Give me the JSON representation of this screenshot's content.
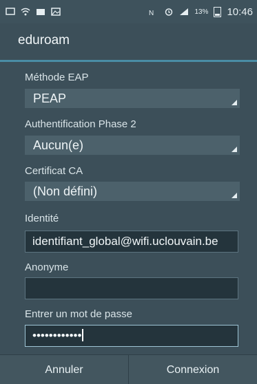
{
  "statusbar": {
    "battery_percent": "13%",
    "time": "10:46"
  },
  "dialog": {
    "title": "eduroam",
    "eap_method": {
      "label": "Méthode EAP",
      "value": "PEAP"
    },
    "phase2": {
      "label": "Authentification Phase 2",
      "value": "Aucun(e)"
    },
    "ca_cert": {
      "label": "Certificat CA",
      "value": "(Non défini)"
    },
    "identity": {
      "label": "Identité",
      "value": "identifiant_global@wifi.uclouvain.be"
    },
    "anonymous": {
      "label": "Anonyme",
      "value": ""
    },
    "password": {
      "label": "Entrer un mot de passe",
      "value": "••••••••••••"
    }
  },
  "buttons": {
    "cancel": "Annuler",
    "connect": "Connexion"
  },
  "colors": {
    "background": "#3c4f59",
    "accent": "#4a8da6"
  }
}
